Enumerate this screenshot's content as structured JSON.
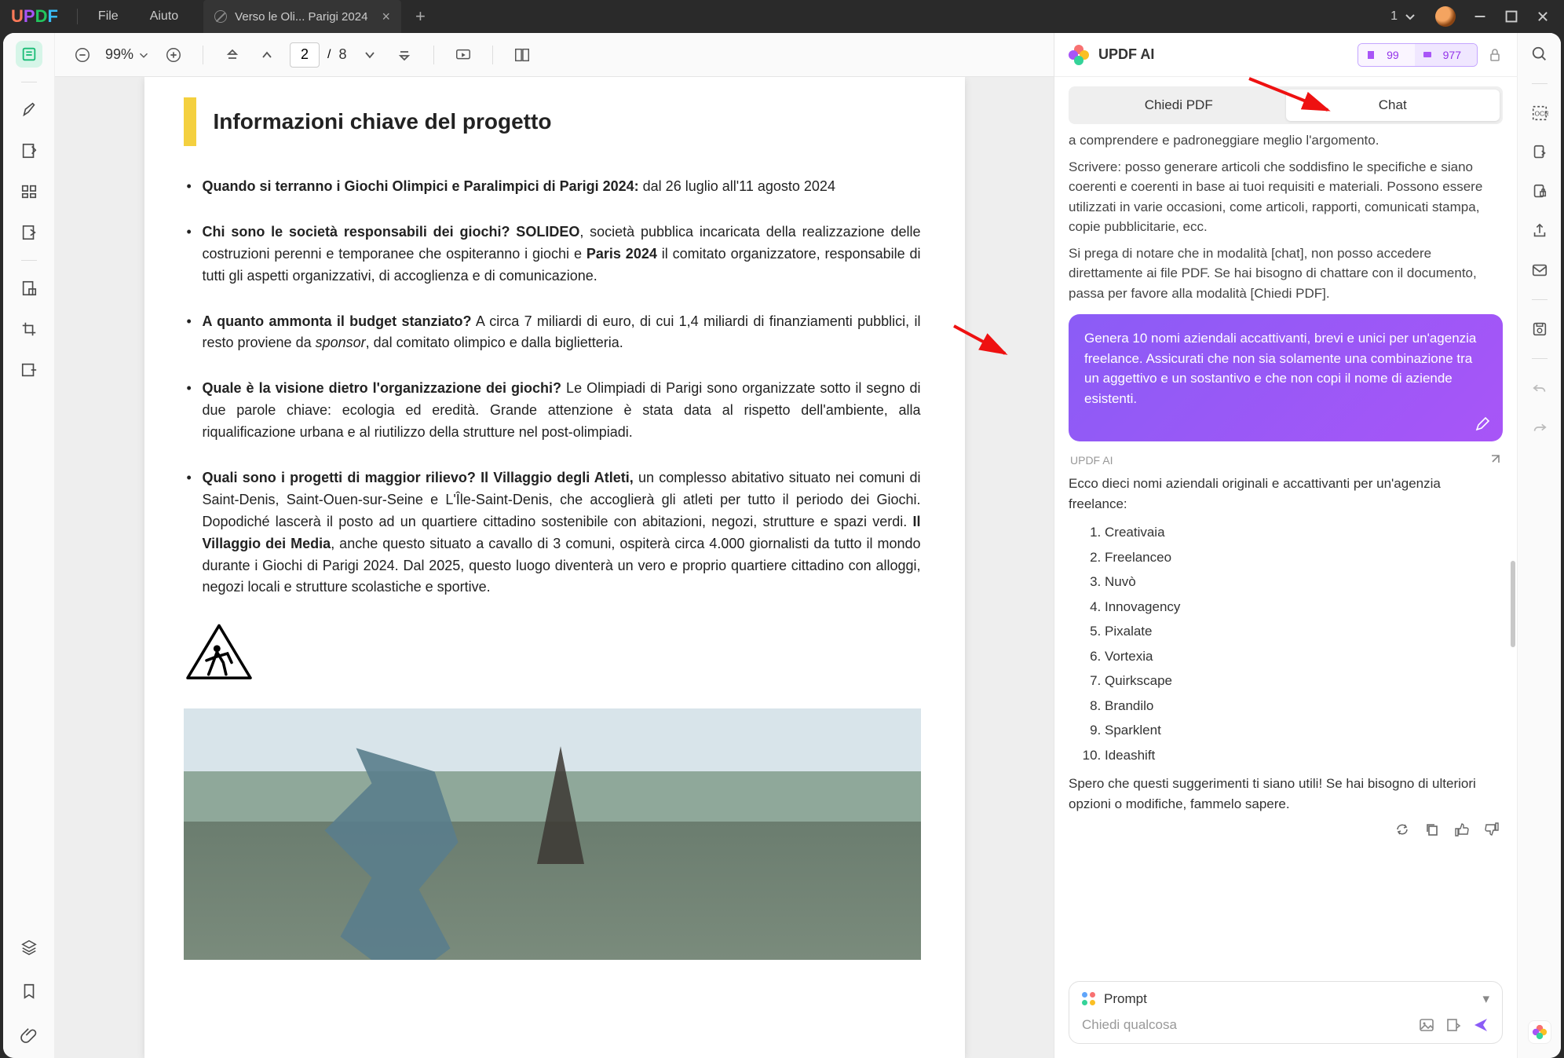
{
  "titlebar": {
    "logo": [
      "U",
      "P",
      "D",
      "F"
    ],
    "file": "File",
    "help": "Aiuto",
    "tab": "Verso le Oli... Parigi 2024",
    "account": "1"
  },
  "toolbar": {
    "zoom": "99%",
    "page_current": "2",
    "page_total": "8"
  },
  "doc": {
    "heading": "Informazioni chiave del progetto",
    "p1_b": "Quando si terranno i Giochi Olimpici e Paralimpici di Parigi 2024:",
    "p1_t": " dal 26 luglio all'11 agosto 2024",
    "p2_b": "Chi sono le società responsabili dei giochi? SOLIDEO",
    "p2_t1": ", società pubblica incaricata della realizzazione delle costruzioni perenni e temporanee che ospiteranno i giochi e ",
    "p2_b2": "Paris 2024",
    "p2_t2": " il comitato organizzatore, responsabile di tutti gli aspetti organizzativi, di accoglienza e di comunicazione.",
    "p3_b": "A quanto ammonta il budget stanziato?",
    "p3_t": " A circa 7 miliardi di euro, di cui 1,4 miliardi di finanziamenti pubblici, il resto proviene da ",
    "p3_i": "sponsor",
    "p3_t2": ", dal comitato olimpico e dalla biglietteria.",
    "p4_b": "Quale è la visione dietro l'organizzazione dei giochi?",
    "p4_t": " Le Olimpiadi di Parigi sono organizzate sotto il segno di due parole chiave: ecologia ed eredità. Grande attenzione è stata data al rispetto dell'ambiente, alla riqualificazione urbana e al riutilizzo della strutture nel post-olimpiadi.",
    "p5_b": "Quali sono i progetti di maggior rilievo? Il Villaggio degli Atleti,",
    "p5_t1": " un complesso abitativo situato nei comuni di Saint-Denis, Saint-Ouen-sur-Seine e L'Île-Saint-Denis, che accoglierà gli atleti per tutto il periodo dei Giochi. Dopodiché lascerà il posto ad un quartiere cittadino sostenibile con abitazioni, negozi, strutture e spazi verdi. ",
    "p5_b2": "Il Villaggio dei Media",
    "p5_t2": ", anche questo situato a cavallo di 3 comuni, ospiterà circa 4.000 giornalisti da tutto il mondo durante i Giochi di Parigi 2024. Dal 2025, questo luogo diventerà un vero e proprio quartiere cittadino con alloggi, negozi locali e strutture scolastiche e sportive."
  },
  "ai": {
    "title": "UPDF AI",
    "tokens1": "99",
    "tokens2": "977",
    "tab1": "Chiedi PDF",
    "tab2": "Chat",
    "sys1": "a comprendere e padroneggiare meglio l'argomento.",
    "sys2": "Scrivere: posso generare articoli che soddisfino le specifiche e siano coerenti e coerenti in base ai tuoi requisiti e materiali. Possono essere utilizzati in varie occasioni, come articoli, rapporti, comunicati stampa, copie pubblicitarie, ecc.",
    "sys3": "Si prega di notare che in modalità [chat], non posso accedere direttamente ai file PDF. Se hai bisogno di chattare con il documento, passa per favore alla modalità [Chiedi PDF].",
    "user": "Genera 10 nomi aziendali accattivanti, brevi e unici per un'agenzia freelance. Assicurati che non sia solamente una combinazione tra un aggettivo e un sostantivo e che non copi il nome di aziende esistenti.",
    "label": "UPDF AI",
    "intro": "Ecco dieci nomi aziendali originali e accattivanti per un'agenzia freelance:",
    "names": [
      "Creativaia",
      "Freelanceo",
      "Nuvò",
      "Innovagency",
      "Pixalate",
      "Vortexia",
      "Quirkscape",
      "Brandilo",
      "Sparklent",
      "Ideashift"
    ],
    "outro": "Spero che questi suggerimenti ti siano utili! Se hai bisogno di ulteriori opzioni o modifiche, fammelo sapere.",
    "prompt": "Prompt",
    "placeholder": "Chiedi qualcosa"
  }
}
